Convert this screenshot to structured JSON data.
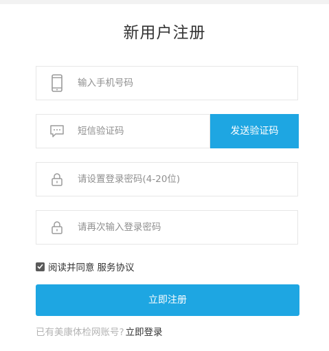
{
  "page": {
    "title": "新用户注册"
  },
  "form": {
    "phone_placeholder": "输入手机号码",
    "sms_code_placeholder": "短信验证码",
    "send_code_label": "发送验证码",
    "password_placeholder": "请设置登录密码(4-20位)",
    "confirm_password_placeholder": "请再次输入登录密码",
    "agree_text": "阅读并同意",
    "agree_checked": true,
    "terms_link": "服务协议",
    "submit_label": "立即注册"
  },
  "footer": {
    "existing_account_text": "已有美康体检网账号?",
    "login_link": "立即登录"
  },
  "icons": {
    "phone": "phone-icon",
    "sms": "message-icon",
    "password": "lock-icon",
    "confirm_password": "lock-icon",
    "checkbox": "check-icon"
  },
  "colors": {
    "accent": "#1ea6e2",
    "icon_gray": "#9a9a9a",
    "placeholder": "#8f8f8f",
    "muted": "#b3b3b3"
  }
}
